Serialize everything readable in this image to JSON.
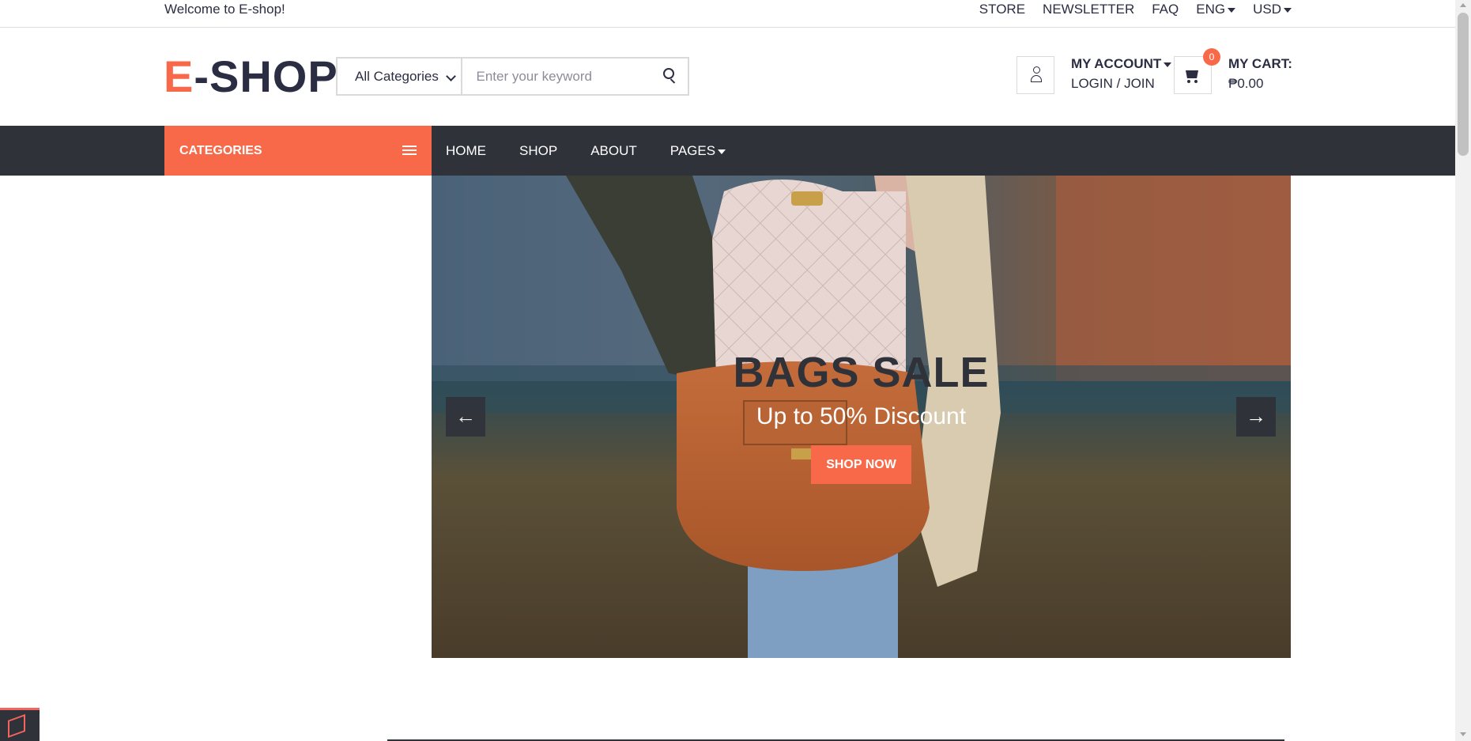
{
  "top_header": {
    "welcome": "Welcome to E-shop!",
    "links": [
      "STORE",
      "NEWSLETTER",
      "FAQ"
    ],
    "language": "ENG",
    "currency": "USD"
  },
  "header": {
    "logo_accent": "E",
    "logo_rest": "-SHOP",
    "search": {
      "category": "All Categories",
      "placeholder": "Enter your keyword",
      "icon": "search-icon"
    },
    "account": {
      "title": "MY ACCOUNT",
      "link": "LOGIN / JOIN",
      "icon": "user-icon"
    },
    "cart": {
      "title": "MY CART:",
      "total": "₱0.00",
      "count": "0",
      "icon": "cart-icon"
    }
  },
  "nav": {
    "categories_label": "CATEGORIES",
    "menu": [
      "HOME",
      "SHOP",
      "ABOUT",
      "PAGES"
    ]
  },
  "banner": {
    "title": "BAGS SALE",
    "subtitle": "Up to 50% Discount",
    "button": "SHOP NOW",
    "prev": "←",
    "next": "→"
  },
  "colors": {
    "accent": "#f8694a",
    "dark": "#30323a",
    "text": "#2b2d42"
  }
}
